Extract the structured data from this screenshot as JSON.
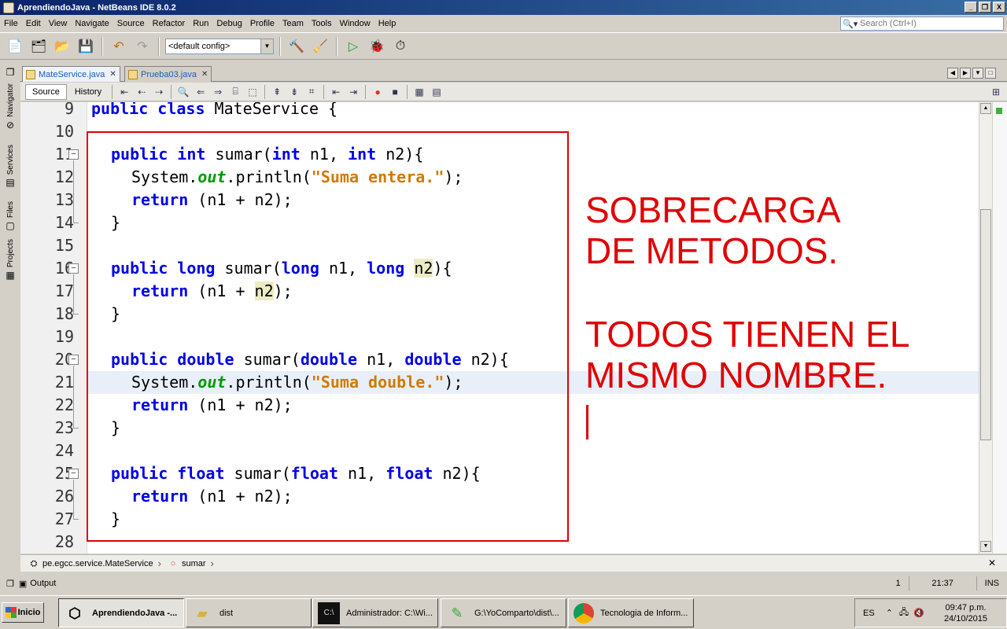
{
  "window": {
    "title": "AprendiendoJava - NetBeans IDE 8.0.2",
    "minimize": "_",
    "maximize": "❐",
    "close": "X"
  },
  "menu": [
    "File",
    "Edit",
    "View",
    "Navigate",
    "Source",
    "Refactor",
    "Run",
    "Debug",
    "Profile",
    "Team",
    "Tools",
    "Window",
    "Help"
  ],
  "search": {
    "placeholder": "Search (Ctrl+I)"
  },
  "toolbar": {
    "config": "<default config>"
  },
  "side_tabs": [
    "Navigator",
    "Services",
    "Files",
    "Projects"
  ],
  "editor_tabs": [
    {
      "label": "MateService.java",
      "active": true
    },
    {
      "label": "Prueba03.java",
      "active": false
    }
  ],
  "source_toolbar": {
    "source": "Source",
    "history": "History"
  },
  "code": [
    {
      "n": "9",
      "fold": ""
    },
    {
      "n": "10",
      "fold": ""
    },
    {
      "n": "11",
      "fold": "-"
    },
    {
      "n": "12",
      "fold": ""
    },
    {
      "n": "13",
      "fold": ""
    },
    {
      "n": "14",
      "fold": ""
    },
    {
      "n": "15",
      "fold": ""
    },
    {
      "n": "16",
      "fold": "-"
    },
    {
      "n": "17",
      "fold": ""
    },
    {
      "n": "18",
      "fold": ""
    },
    {
      "n": "19",
      "fold": ""
    },
    {
      "n": "20",
      "fold": "-"
    },
    {
      "n": "21",
      "fold": ""
    },
    {
      "n": "22",
      "fold": ""
    },
    {
      "n": "23",
      "fold": ""
    },
    {
      "n": "24",
      "fold": ""
    },
    {
      "n": "25",
      "fold": "-"
    },
    {
      "n": "26",
      "fold": ""
    },
    {
      "n": "27",
      "fold": ""
    },
    {
      "n": "28",
      "fold": ""
    }
  ],
  "code_text": {
    "l9_kw": "public class",
    "l9_rest": " MateService {",
    "l11": [
      "public int",
      " sumar(",
      "int",
      " n1, ",
      "int",
      " n2){"
    ],
    "l12": [
      "System.",
      "out",
      ".println(",
      "\"Suma entera.\"",
      ");"
    ],
    "l13": [
      "return",
      " (n1 + n2);"
    ],
    "brace": "}",
    "l16": [
      "public long",
      " sumar(",
      "long",
      " n1, ",
      "long",
      " ",
      "n2",
      "){"
    ],
    "l17": [
      "return",
      " (n1 + ",
      "n2",
      ");"
    ],
    "l20": [
      "public double",
      " sumar(",
      "double",
      " n1, ",
      "double",
      " n2){"
    ],
    "l21": [
      "System.",
      "out",
      ".println(",
      "\"Suma double.\"",
      ");"
    ],
    "l22": [
      "return",
      " (n1 + n2);"
    ],
    "l25": [
      "public float",
      " sumar(",
      "float",
      " n1, ",
      "float",
      " n2){"
    ],
    "l26": [
      "return",
      " (n1 + n2);"
    ]
  },
  "annotation": {
    "line1": "SOBRECARGA",
    "line2": "DE METODOS.",
    "line3": "TODOS TIENEN EL",
    "line4": "MISMO NOMBRE."
  },
  "breadcrumb": {
    "class": "pe.egcc.service.MateService",
    "method": "sumar"
  },
  "output": {
    "label": "Output"
  },
  "status": {
    "position": "21:37",
    "mode": "INS",
    "notification": "1"
  },
  "taskbar": {
    "start": "Inicio",
    "tasks": [
      "AprendiendoJava -...",
      "dist",
      "Administrador: C:\\Wi...",
      "G:\\YoComparto\\dist\\...",
      "Tecnologia de Inform..."
    ],
    "lang": "ES",
    "time": "09:47 p.m.",
    "date": "24/10/2015"
  },
  "colors": {
    "keyword": "#0000e6",
    "string": "#ce7b00",
    "field": "#009900",
    "annotation": "#e00000"
  }
}
